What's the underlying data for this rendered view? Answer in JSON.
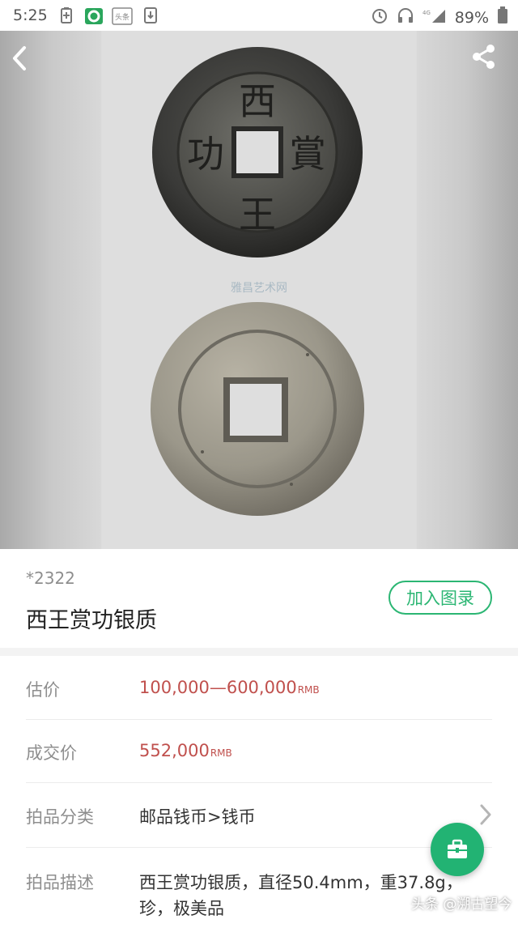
{
  "status_bar": {
    "time": "5:25",
    "app_icon_label": "头条",
    "network": "4G",
    "battery": "89%"
  },
  "nav": {
    "back_icon": "chevron-left-icon",
    "share_icon": "share-icon"
  },
  "hero": {
    "coin_front_chars": [
      "西",
      "王",
      "賞",
      "功"
    ],
    "watermark": "雅昌艺术网"
  },
  "lot": {
    "number": "*2322",
    "title": "西王赏功银质",
    "add_catalog_label": "加入图录"
  },
  "details": [
    {
      "label": "估价",
      "value": "100,000—600,000",
      "unit": "RMB"
    },
    {
      "label": "成交价",
      "value": "552,000",
      "unit": "RMB"
    },
    {
      "label": "拍品分类",
      "value": "邮品钱币>钱币"
    },
    {
      "label": "拍品描述",
      "value_line1": "西王赏功银质，直径50.4mm，重37.8g，",
      "value_line2": "珍，极美品"
    }
  ],
  "overlay": {
    "fab_icon": "briefcase-icon",
    "credit": "头条 @溯古望今"
  },
  "colors": {
    "accent_green": "#2bb673",
    "price_red": "#c0504d"
  }
}
